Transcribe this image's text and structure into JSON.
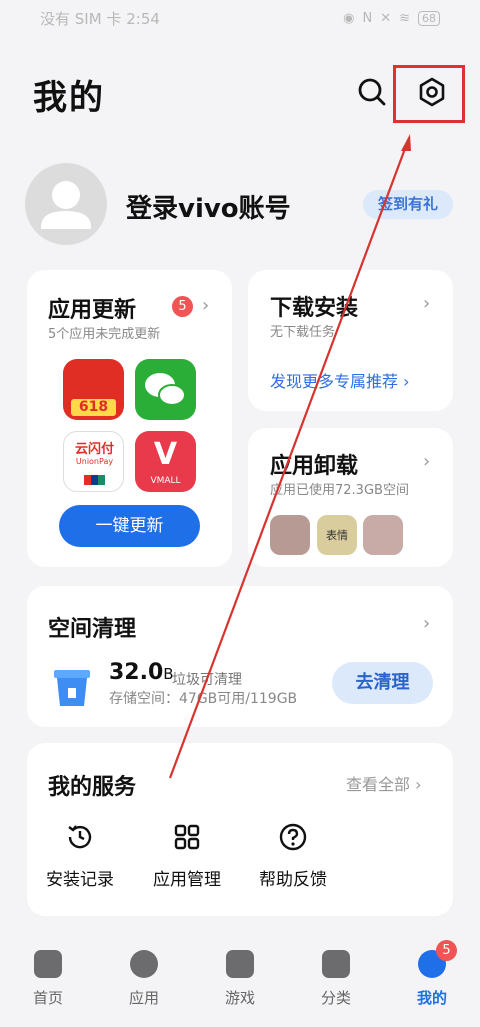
{
  "status_bar": {
    "left_text": "没有 SIM 卡",
    "time": "2:54",
    "battery": "68"
  },
  "header": {
    "title": "我的"
  },
  "profile": {
    "login_text": "登录vivo账号",
    "signin_label": "签到有礼"
  },
  "app_update": {
    "title": "应用更新",
    "badge": "5",
    "subtitle": "5个应用未完成更新",
    "button": "一键更新",
    "app_labels": [
      "618",
      "云闪付",
      "UnionPay",
      "VMALL"
    ]
  },
  "download": {
    "title": "下载安装",
    "subtitle": "无下载任务",
    "link": "发现更多专属推荐 ›"
  },
  "uninstall": {
    "title": "应用卸载",
    "subtitle": "应用已使用72.3GB空间",
    "mini_label": "表情"
  },
  "storage": {
    "title": "空间清理",
    "amount": "32.0",
    "unit": "B",
    "amount_label": "垃圾可清理",
    "detail": "存储空间：47GB可用/119GB",
    "button": "去清理"
  },
  "services": {
    "title": "我的服务",
    "view_all": "查看全部 ›",
    "items": [
      "安装记录",
      "应用管理",
      "帮助反馈"
    ]
  },
  "tabbar": {
    "items": [
      "首页",
      "应用",
      "游戏",
      "分类",
      "我的"
    ],
    "badge": "5"
  },
  "colors": {
    "accent": "#1e6fe8",
    "annotation": "#e03131"
  }
}
